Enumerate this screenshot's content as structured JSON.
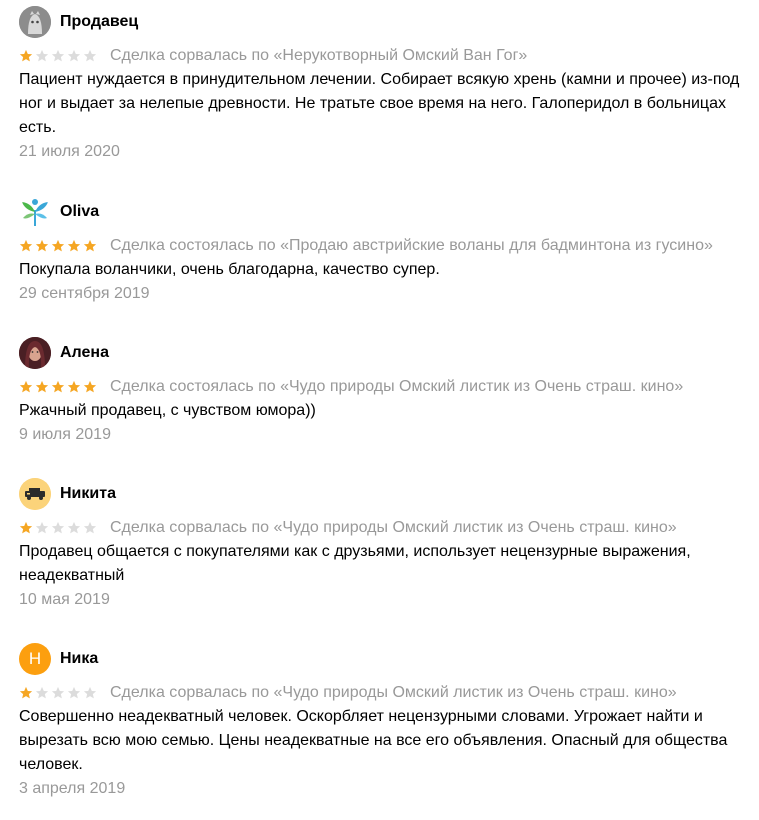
{
  "colors": {
    "star_filled": "#f5a623",
    "star_empty": "#dcdcdc",
    "muted_text": "#999999",
    "avatar_h": "#fc9f0f"
  },
  "reviews": [
    {
      "name": "Продавец",
      "avatar_icon": "ghost-avatar-icon",
      "rating": 1,
      "deal": "Сделка сорвалась по «Нерукотворный Омский Ван Гог»",
      "text": "Пациент нуждается в принудительном лечении. Собирает всякую хрень (камни и прочее) из-под ног и выдает за нелепые древности. Не тратьте свое время на него. Галоперидол в больницах есть.",
      "date": "21 июля 2020"
    },
    {
      "name": "Oliva",
      "avatar_icon": "leaf-logo-avatar-icon",
      "rating": 5,
      "deal": "Сделка состоялась по «Продаю австрийские воланы для бадминтона из гусино»",
      "text": "Покупала воланчики, очень благодарна, качество супер.",
      "date": "29 сентября 2019"
    },
    {
      "name": "Алена",
      "avatar_icon": "photo-avatar-icon",
      "rating": 5,
      "deal": "Сделка состоялась по «Чудо природы Омский листик из Очень страш. кино»",
      "text": "Ржачный продавец, с чувством юмора))",
      "date": "9 июля 2019"
    },
    {
      "name": "Никита",
      "avatar_icon": "car-avatar-icon",
      "rating": 1,
      "deal": "Сделка сорвалась по «Чудо природы Омский листик из Очень страш. кино»",
      "text": "Продавец общается с покупателями как с друзьями, использует нецензурные выражения, неадекватный",
      "date": "10 мая 2019"
    },
    {
      "name": "Ника",
      "avatar_letter": "Н",
      "rating": 1,
      "deal": "Сделка сорвалась по «Чудо природы Омский листик из Очень страш. кино»",
      "text": "Совершенно неадекватный человек. Оскорбляет нецензурными словами. Угрожает найти и вырезать всю мою семью. Цены неадекватные на все его объявления. Опасный для общества человек.",
      "date": "3 апреля 2019"
    }
  ]
}
